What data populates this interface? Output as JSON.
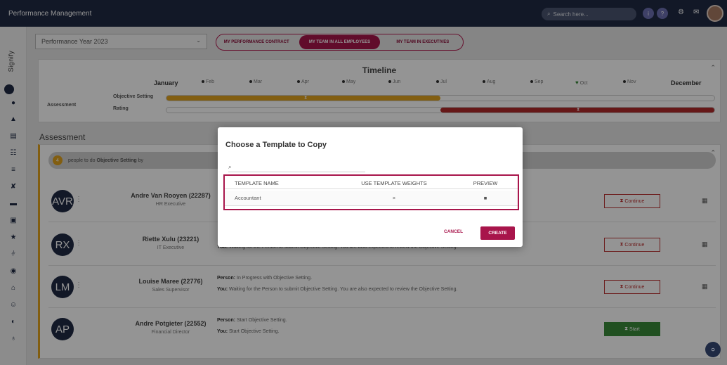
{
  "app": {
    "title": "Performance Management"
  },
  "topbar": {
    "search_placeholder": "Search here...",
    "search_icon": "search-icon",
    "info_icon": "i",
    "help_icon": "?",
    "settings_icon": "gear-icon",
    "mail_icon": "mail-icon"
  },
  "sidebar": {
    "logo": "Signify",
    "items": [
      "dashboard",
      "person",
      "id-card",
      "team",
      "bar-chart",
      "award",
      "graduation",
      "calendar",
      "star",
      "hierarchy",
      "eye",
      "org",
      "person-plus",
      "target",
      "globe"
    ]
  },
  "filters": {
    "year": "Performance Year 2023",
    "tabs": [
      "MY PERFORMANCE CONTRACT",
      "MY TEAM IN ALL EMPLOYEES",
      "MY TEAM IN EXECUTIVES"
    ],
    "active_tab": "MY TEAM IN ALL EMPLOYEES"
  },
  "timeline": {
    "title": "Timeline",
    "months": [
      "January",
      "Feb",
      "Mar",
      "Apr",
      "May",
      "Jun",
      "Jul",
      "Aug",
      "Sep",
      "Oct",
      "Nov",
      "December"
    ],
    "current_month": "Oct",
    "group_label": "Assessment",
    "tracks": [
      {
        "label": "Objective Setting",
        "color": "#e0a21e",
        "start_fraction": 0.0,
        "end_fraction": 0.5
      },
      {
        "label": "Rating",
        "color": "#b02a2a",
        "start_fraction": 0.5,
        "end_fraction": 1.0
      }
    ]
  },
  "assessment": {
    "section_title": "Assessment",
    "count": "4",
    "people_text_prefix": "people to do",
    "people_text_bold": "Objective Setting",
    "people_text_suffix": "by",
    "rows": [
      {
        "initials": "AVR",
        "name": "Andre Van Rooyen (22287)",
        "role": "HR Executive",
        "person_label": "",
        "person_status": "",
        "you_label": "",
        "you_status": "",
        "action": "Continue",
        "action_style": "outline"
      },
      {
        "initials": "RX",
        "name": "Riette Xulu (23221)",
        "role": "IT Executive",
        "person_label": "",
        "person_status": "",
        "you_label": "You:",
        "you_status": "Waiting for the Person to submit Objective Setting. You are also expected to review the Objective Setting.",
        "action": "Continue",
        "action_style": "outline"
      },
      {
        "initials": "LM",
        "name": "Louise Maree (22776)",
        "role": "Sales Supervisor",
        "person_label": "Person:",
        "person_status": "In Progress with Objective Setting.",
        "you_label": "You:",
        "you_status": "Waiting for the Person to submit Objective Setting. You are also expected to review the Objective Setting.",
        "action": "Continue",
        "action_style": "outline"
      },
      {
        "initials": "AP",
        "name": "Andre Potgieter (22552)",
        "role": "Financial Director",
        "person_label": "Person:",
        "person_status": "Start Objective Setting.",
        "you_label": "You:",
        "you_status": "Start Objective Setting.",
        "action": "Start",
        "action_style": "green"
      }
    ]
  },
  "modal": {
    "title": "Choose a Template to Copy",
    "search_placeholder": "",
    "columns": [
      "TEMPLATE NAME",
      "USE TEMPLATE WEIGHTS",
      "PREVIEW"
    ],
    "rows": [
      {
        "name": "Accountant",
        "use_weights": "×",
        "preview_icon": "document-icon"
      }
    ],
    "cancel_label": "CANCEL",
    "create_label": "CREATE"
  },
  "colors": {
    "brand": "#a8154b",
    "navbar": "#1f2a44",
    "objective": "#e0a21e",
    "rating": "#b02a2a",
    "start": "#3a8a3a"
  }
}
